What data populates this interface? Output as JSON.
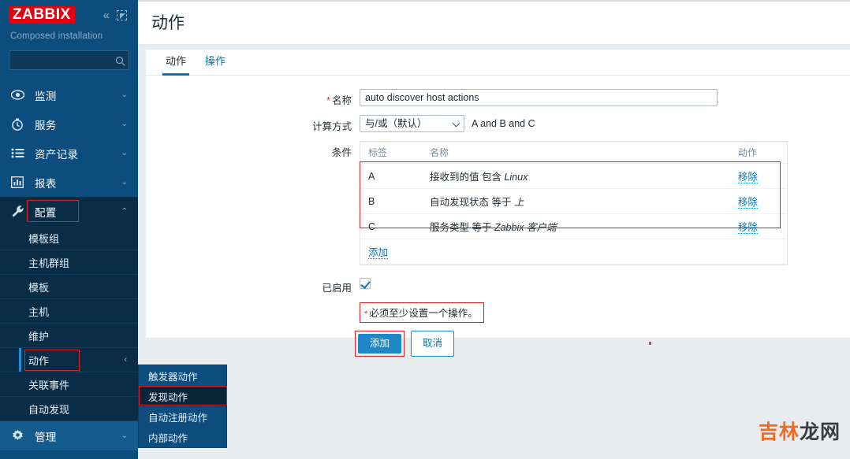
{
  "sidebar": {
    "logo": "ZABBIX",
    "subtitle": "Composed installation",
    "search_placeholder": "",
    "search_value": "",
    "icons": {
      "collapse": "«",
      "compact": "compact-view-icon",
      "search": "search-icon"
    },
    "nav": [
      {
        "label": "监测",
        "icon": "eye-icon",
        "chevron": "⌄"
      },
      {
        "label": "服务",
        "icon": "clock-icon",
        "chevron": "⌄"
      },
      {
        "label": "资产记录",
        "icon": "list-icon",
        "chevron": "⌄"
      },
      {
        "label": "报表",
        "icon": "bar-chart-icon",
        "chevron": "⌄"
      },
      {
        "label": "配置",
        "icon": "wrench-icon",
        "chevron": "⌃"
      }
    ],
    "subnav": [
      {
        "label": "模板组"
      },
      {
        "label": "主机群组"
      },
      {
        "label": "模板"
      },
      {
        "label": "主机"
      },
      {
        "label": "维护"
      },
      {
        "label": "动作",
        "arrow": "‹"
      },
      {
        "label": "关联事件"
      },
      {
        "label": "自动发现"
      }
    ],
    "bottom_nav": {
      "label": "管理",
      "icon": "gear-icon",
      "chevron": "⌄"
    },
    "flyout": [
      {
        "label": "触发器动作"
      },
      {
        "label": "发现动作"
      },
      {
        "label": "自动注册动作"
      },
      {
        "label": "内部动作"
      }
    ]
  },
  "header": {
    "title": "动作"
  },
  "tabs": [
    {
      "label": "动作"
    },
    {
      "label": "操作"
    }
  ],
  "form": {
    "name_label": "名称",
    "name_value": "auto discover host actions",
    "calc_label": "计算方式",
    "calc_value": "与/或（默认）",
    "calc_options": [
      "与/或（默认）"
    ],
    "formula": "A and B and C",
    "conditions_label": "条件",
    "cond_headers": {
      "label": "标签",
      "name": "名称",
      "action": "动作"
    },
    "conditions": [
      {
        "label": "A",
        "name_prefix": "接收到的值 包含 ",
        "name_italic": "Linux",
        "action": "移除"
      },
      {
        "label": "B",
        "name_prefix": "自动发现状态 等于 ",
        "name_italic": "上",
        "action": "移除"
      },
      {
        "label": "C",
        "name_prefix": "服务类型 等于 ",
        "name_italic": "Zabbix 客户端",
        "action": "移除"
      }
    ],
    "add_condition": "添加",
    "enabled_label": "已启用",
    "enabled_checked": true,
    "warning": "必须至少设置一个操作。",
    "submit_label": "添加",
    "cancel_label": "取消"
  },
  "watermark": {
    "part1": "吉林",
    "part2": "龙网"
  },
  "colors": {
    "brand_red": "#e8000f",
    "sidebar_blue": "#0c4d7e",
    "sidebar_dark": "#0a2d47",
    "accent_blue": "#0275b8",
    "button_blue": "#1e87c8",
    "highlight_red": "#e02020",
    "required_red": "#d12d2d",
    "watermark_orange": "#f26a21"
  }
}
